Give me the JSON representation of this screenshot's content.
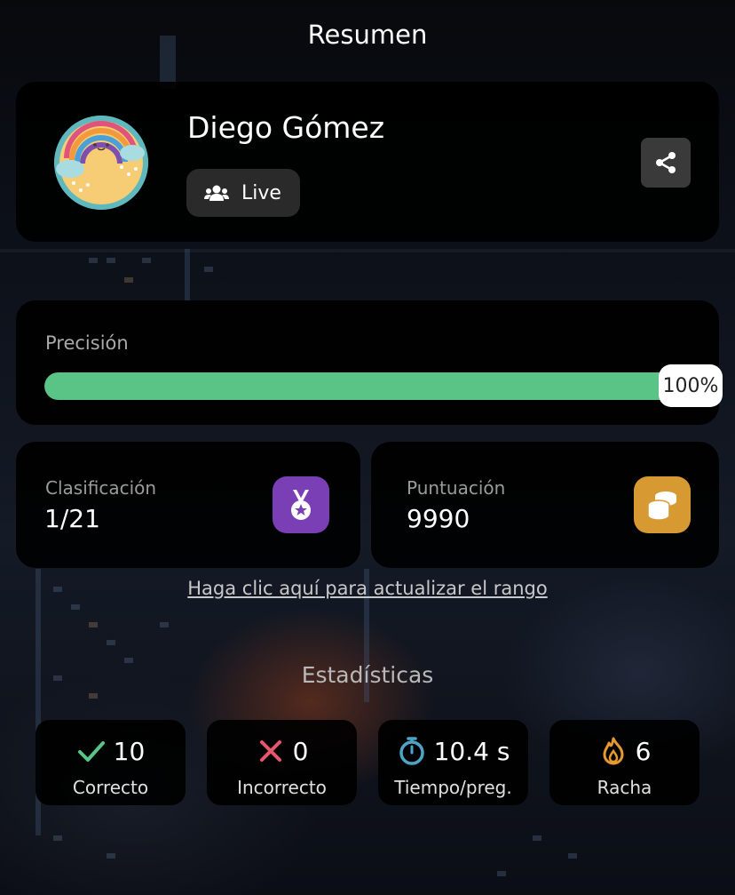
{
  "header": {
    "title": "Resumen"
  },
  "profile": {
    "name": "Diego Gómez",
    "mode_label": "Live",
    "avatar_icon": "rainbow-cloud-avatar",
    "share_icon": "share-icon"
  },
  "precision": {
    "label": "Precisión",
    "value_label": "100%",
    "value_fraction": 1.0,
    "bar_color": "#5ac487"
  },
  "ranking": {
    "label": "Clasificación",
    "value": "1/21",
    "icon": "medal-icon",
    "icon_color": "#7b3fb5"
  },
  "score": {
    "label": "Puntuación",
    "value": "9990",
    "icon": "coins-icon",
    "icon_color": "#d79a32"
  },
  "update_link": "Haga clic aquí para actualizar el rango",
  "stats": {
    "heading": "Estadísticas",
    "items": [
      {
        "icon": "check-icon",
        "value": "10",
        "label": "Correcto",
        "color": "#5ac487"
      },
      {
        "icon": "cross-icon",
        "value": "0",
        "label": "Incorrecto",
        "color": "#e7556e"
      },
      {
        "icon": "stopwatch-icon",
        "value": "10.4 s",
        "label": "Tiempo/preg.",
        "color": "#4fa3c7"
      },
      {
        "icon": "flame-icon",
        "value": "6",
        "label": "Racha",
        "color": "#e69a30"
      }
    ]
  }
}
